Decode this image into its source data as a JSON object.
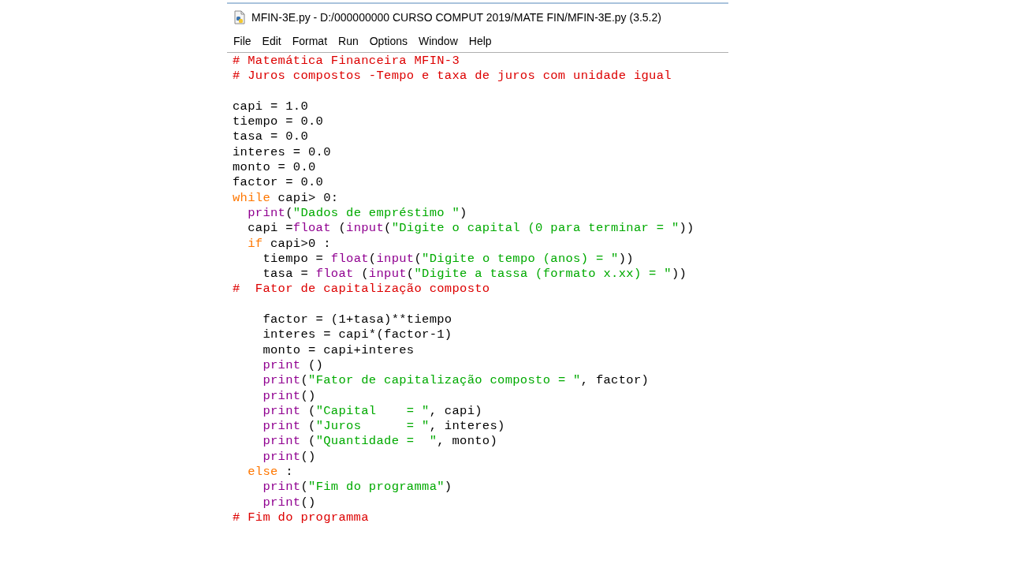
{
  "window": {
    "title": "MFIN-3E.py - D:/000000000 CURSO COMPUT 2019/MATE FIN/MFIN-3E.py (3.5.2)"
  },
  "menu": [
    "File",
    "Edit",
    "Format",
    "Run",
    "Options",
    "Window",
    "Help"
  ],
  "editor": {
    "lines": [
      {
        "kind": "code",
        "tokens": [
          {
            "kind": "comment",
            "text": "# Matemática Financeira MFIN-3"
          }
        ]
      },
      {
        "kind": "code",
        "tokens": [
          {
            "kind": "comment",
            "text": "# Juros compostos -Tempo e taxa de juros com unidade igual"
          }
        ]
      },
      {
        "kind": "blank"
      },
      {
        "kind": "code",
        "tokens": [
          {
            "kind": "plain",
            "text": "capi = 1.0"
          }
        ]
      },
      {
        "kind": "code",
        "tokens": [
          {
            "kind": "plain",
            "text": "tiempo = 0.0"
          }
        ]
      },
      {
        "kind": "code",
        "tokens": [
          {
            "kind": "plain",
            "text": "tasa = 0.0"
          }
        ]
      },
      {
        "kind": "code",
        "tokens": [
          {
            "kind": "plain",
            "text": "interes = 0.0"
          }
        ]
      },
      {
        "kind": "code",
        "tokens": [
          {
            "kind": "plain",
            "text": "monto = 0.0"
          }
        ]
      },
      {
        "kind": "code",
        "tokens": [
          {
            "kind": "plain",
            "text": "factor = 0.0"
          }
        ]
      },
      {
        "kind": "code",
        "tokens": [
          {
            "kind": "keyword",
            "text": "while"
          },
          {
            "kind": "plain",
            "text": " capi> 0:"
          }
        ]
      },
      {
        "kind": "code",
        "tokens": [
          {
            "kind": "builtin",
            "text": "  print"
          },
          {
            "kind": "plain",
            "text": "("
          },
          {
            "kind": "string",
            "text": "\"Dados de empréstimo \""
          },
          {
            "kind": "plain",
            "text": ")"
          }
        ]
      },
      {
        "kind": "code",
        "tokens": [
          {
            "kind": "plain",
            "text": "  capi ="
          },
          {
            "kind": "builtin",
            "text": "float"
          },
          {
            "kind": "plain",
            "text": " ("
          },
          {
            "kind": "builtin",
            "text": "input"
          },
          {
            "kind": "plain",
            "text": "("
          },
          {
            "kind": "string",
            "text": "\"Digite o capital (0 para terminar = \""
          },
          {
            "kind": "plain",
            "text": "))"
          }
        ]
      },
      {
        "kind": "code",
        "tokens": [
          {
            "kind": "keyword",
            "text": "  if"
          },
          {
            "kind": "plain",
            "text": " capi>0 :"
          }
        ]
      },
      {
        "kind": "code",
        "tokens": [
          {
            "kind": "plain",
            "text": "    tiempo = "
          },
          {
            "kind": "builtin",
            "text": "float"
          },
          {
            "kind": "plain",
            "text": "("
          },
          {
            "kind": "builtin",
            "text": "input"
          },
          {
            "kind": "plain",
            "text": "("
          },
          {
            "kind": "string",
            "text": "\"Digite o tempo (anos) = \""
          },
          {
            "kind": "plain",
            "text": "))"
          }
        ]
      },
      {
        "kind": "code",
        "tokens": [
          {
            "kind": "plain",
            "text": "    tasa = "
          },
          {
            "kind": "builtin",
            "text": "float"
          },
          {
            "kind": "plain",
            "text": " ("
          },
          {
            "kind": "builtin",
            "text": "input"
          },
          {
            "kind": "plain",
            "text": "("
          },
          {
            "kind": "string",
            "text": "\"Digite a tassa (formato x.xx) = \""
          },
          {
            "kind": "plain",
            "text": "))"
          }
        ]
      },
      {
        "kind": "code",
        "tokens": [
          {
            "kind": "comment",
            "text": "#  Fator de capitalização composto"
          }
        ]
      },
      {
        "kind": "blank"
      },
      {
        "kind": "code",
        "tokens": [
          {
            "kind": "plain",
            "text": "    factor = (1+tasa)**tiempo"
          }
        ]
      },
      {
        "kind": "code",
        "tokens": [
          {
            "kind": "plain",
            "text": "    interes = capi*(factor-1)"
          }
        ]
      },
      {
        "kind": "code",
        "tokens": [
          {
            "kind": "plain",
            "text": "    monto = capi+interes"
          }
        ]
      },
      {
        "kind": "code",
        "tokens": [
          {
            "kind": "builtin",
            "text": "    print"
          },
          {
            "kind": "plain",
            "text": " ()"
          }
        ]
      },
      {
        "kind": "code",
        "tokens": [
          {
            "kind": "builtin",
            "text": "    print"
          },
          {
            "kind": "plain",
            "text": "("
          },
          {
            "kind": "string",
            "text": "\"Fator de capitalização composto = \""
          },
          {
            "kind": "plain",
            "text": ", factor)"
          }
        ]
      },
      {
        "kind": "code",
        "tokens": [
          {
            "kind": "builtin",
            "text": "    print"
          },
          {
            "kind": "plain",
            "text": "()"
          }
        ]
      },
      {
        "kind": "code",
        "tokens": [
          {
            "kind": "builtin",
            "text": "    print"
          },
          {
            "kind": "plain",
            "text": " ("
          },
          {
            "kind": "string",
            "text": "\"Capital    = \""
          },
          {
            "kind": "plain",
            "text": ", capi)"
          }
        ]
      },
      {
        "kind": "code",
        "tokens": [
          {
            "kind": "builtin",
            "text": "    print"
          },
          {
            "kind": "plain",
            "text": " ("
          },
          {
            "kind": "string",
            "text": "\"Juros      = \""
          },
          {
            "kind": "plain",
            "text": ", interes)"
          }
        ]
      },
      {
        "kind": "code",
        "tokens": [
          {
            "kind": "builtin",
            "text": "    print"
          },
          {
            "kind": "plain",
            "text": " ("
          },
          {
            "kind": "string",
            "text": "\"Quantidade =  \""
          },
          {
            "kind": "plain",
            "text": ", monto)"
          }
        ]
      },
      {
        "kind": "code",
        "tokens": [
          {
            "kind": "builtin",
            "text": "    print"
          },
          {
            "kind": "plain",
            "text": "()"
          }
        ]
      },
      {
        "kind": "code",
        "tokens": [
          {
            "kind": "keyword",
            "text": "  else"
          },
          {
            "kind": "plain",
            "text": " :"
          }
        ]
      },
      {
        "kind": "code",
        "tokens": [
          {
            "kind": "builtin",
            "text": "    print"
          },
          {
            "kind": "plain",
            "text": "("
          },
          {
            "kind": "string",
            "text": "\"Fim do programma\""
          },
          {
            "kind": "plain",
            "text": ")"
          }
        ]
      },
      {
        "kind": "code",
        "tokens": [
          {
            "kind": "builtin",
            "text": "    print"
          },
          {
            "kind": "plain",
            "text": "()"
          }
        ]
      },
      {
        "kind": "code",
        "tokens": [
          {
            "kind": "comment",
            "text": "# Fim do programma"
          }
        ]
      }
    ]
  }
}
